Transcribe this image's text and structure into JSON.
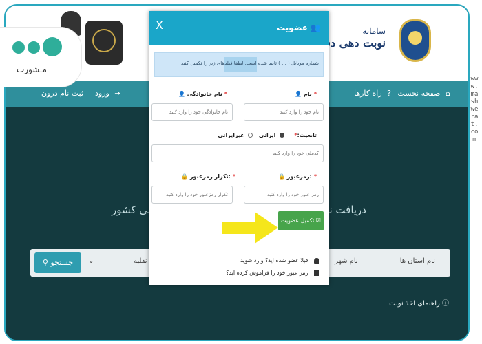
{
  "header": {
    "title_line1": "سامانه",
    "title_line2": "نوبت دهی دفتری"
  },
  "nav": {
    "items": [
      {
        "label": "صفحه نخست",
        "icon": "home-icon"
      },
      {
        "label": "راه کارها",
        "icon": "info-icon"
      },
      {
        "label": "ورود",
        "icon": "login-icon"
      },
      {
        "label": "ثبت نام درون",
        "icon": "user-plus-icon"
      }
    ]
  },
  "hero": {
    "text_right": "دریافت نوبت",
    "text_left": "دروبی کشور"
  },
  "searchbar": {
    "button_label": "جستجو",
    "field_state": "نام استان ها",
    "field_city": "نام شهر",
    "field_vehicle": "وسایل نقلیه"
  },
  "guide": {
    "label": "راهنمای اخذ نوبت"
  },
  "logo": {
    "text": "مـشورت"
  },
  "watermark": {
    "text": "www.mashwerat.com"
  },
  "modal": {
    "title": "عضویت",
    "close_label": "X",
    "notice": "شماره موبایل ( ... ) تایید شده است. لطفا فیلدهای زیر را تکمیل کنید",
    "first_name": {
      "label": "نام",
      "placeholder": "نام خود را وارد کنید"
    },
    "last_name": {
      "label": "نام خانوادگی",
      "placeholder": "نام خانوادگی خود را وارد کنید"
    },
    "nationality": {
      "label": "تابعیت:",
      "options": [
        "ایرانی",
        "غیرایرانی"
      ],
      "selected": "ایرانی"
    },
    "national_code": {
      "placeholder": "کدملی خود را وارد کنید"
    },
    "password": {
      "label": "رمزعبور:",
      "placeholder": "رمز عبور خود را وارد کنید"
    },
    "password_repeat": {
      "label": "تکرار رمزعبور:",
      "placeholder": "تکرار رمزعبور خود را وارد کنید"
    },
    "submit_label": "تکمیل عضویت",
    "link_login": "قبلا عضو شده اید؟ وارد شوید",
    "link_forgot": "رمز عبور خود را فراموش کرده اید؟"
  },
  "colors": {
    "modal_header": "#1aa6c9",
    "submit": "#47a44b",
    "navbar": "#2f8f9c",
    "arrow": "#f5e61b"
  }
}
